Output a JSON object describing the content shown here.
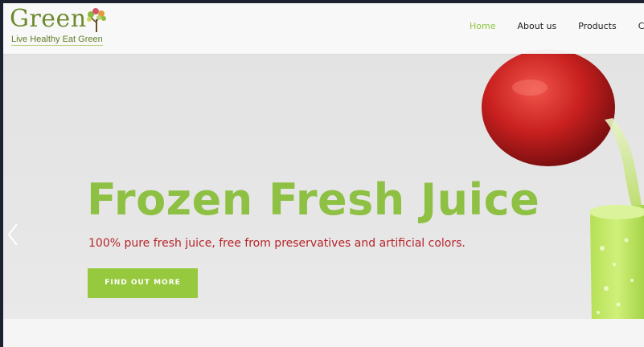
{
  "logo": {
    "word": "Green",
    "tagline": "Live Healthy Eat Green",
    "icon": "tree-icon"
  },
  "nav": {
    "items": [
      {
        "label": "Home",
        "active": true
      },
      {
        "label": "About us",
        "active": false
      },
      {
        "label": "Products",
        "active": false
      },
      {
        "label": "Ce",
        "active": false
      }
    ]
  },
  "hero": {
    "headline": "Frozen Fresh Juice",
    "subtitle": "100% pure fresh juice, free from preservatives and artificial colors.",
    "cta_label": "FIND OUT MORE",
    "prev_icon": "chevron-left-icon",
    "illustration": "apple-juice-pour"
  },
  "colors": {
    "accent_green": "#8dc043",
    "subtitle_red": "#b6242a",
    "nav_active": "#8cc43f"
  }
}
